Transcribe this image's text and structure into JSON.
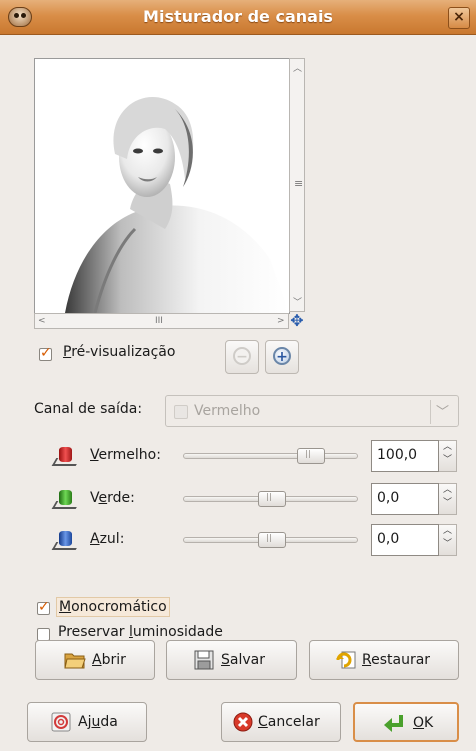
{
  "window": {
    "title": "Misturador de canais",
    "close_icon": "close-icon"
  },
  "preview": {
    "label_prefix": "",
    "label_underlined": "P",
    "label_rest": "ré-visualização",
    "checked": true
  },
  "output_channel": {
    "label": "Canal de saída:",
    "value": "Vermelho"
  },
  "channels": [
    {
      "label_u": "V",
      "label_rest": "ermelho:",
      "value": "100,0",
      "color": "#d62b2b",
      "level": 1.0
    },
    {
      "label_u": "",
      "label_rest": "",
      "label_pre": "V",
      "label_u2": "e",
      "label_rest2": "rde:",
      "value": "0,0",
      "color": "#3fa82a",
      "level": 0.0
    },
    {
      "label_u": "A",
      "label_rest": "zul:",
      "value": "0,0",
      "color": "#2c5bbd",
      "level": 0.0
    }
  ],
  "options": {
    "monochrome": {
      "label_u": "M",
      "label_rest": "onocromático",
      "checked": true
    },
    "preserve": {
      "label_pre": "Preservar ",
      "label_u": "l",
      "label_rest": "uminosidade",
      "checked": false
    }
  },
  "buttons": {
    "open": {
      "label_u": "A",
      "label_rest": "brir"
    },
    "save": {
      "label_u": "S",
      "label_rest": "alvar"
    },
    "reset": {
      "label_u": "R",
      "label_rest": "estaurar"
    },
    "help": {
      "label_pre": "Aj",
      "label_u": "u",
      "label_rest": "da"
    },
    "cancel": {
      "label_u": "C",
      "label_rest": "ancelar"
    },
    "ok": {
      "label_u": "O",
      "label_rest": "K"
    }
  },
  "scrollbars": {
    "h_grip": "III",
    "v_grip": "≡"
  }
}
